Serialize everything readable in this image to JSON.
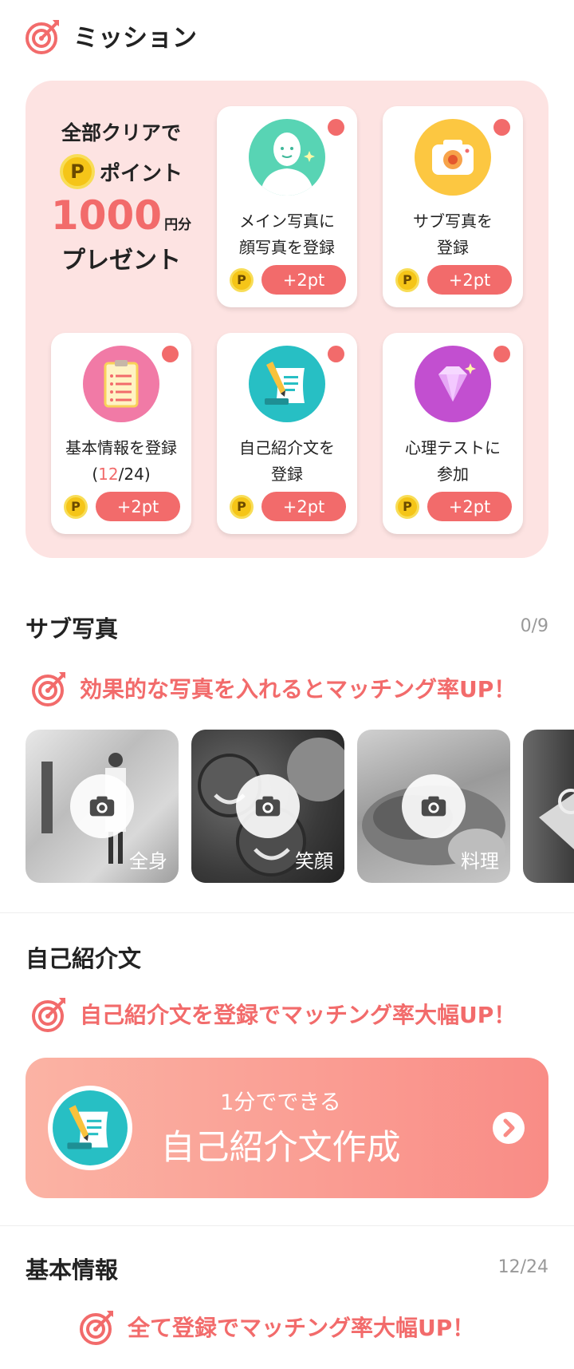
{
  "header": {
    "title": "ミッション",
    "icon": "target-icon"
  },
  "mission": {
    "clear_line1": "全部クリアで",
    "coin_label": "P",
    "points_label": "ポイント",
    "amount": "1000",
    "unit": "円分",
    "present": "プレゼント",
    "accent_color": "#f26b6b",
    "cards": [
      {
        "line1": "メイン写真に",
        "line2": "顔写真を登録",
        "reward": "+2pt",
        "icon": "user-photo-icon"
      },
      {
        "line1": "サブ写真を",
        "line2": "登録",
        "reward": "+2pt",
        "icon": "camera-icon"
      },
      {
        "line1": "基本情報を登録",
        "progress_open": "(",
        "progress_done": "12",
        "progress_rest": "/24)",
        "reward": "+2pt",
        "icon": "clipboard-icon"
      },
      {
        "line1": "自己紹介文を",
        "line2": "登録",
        "reward": "+2pt",
        "icon": "writing-icon"
      },
      {
        "line1": "心理テストに",
        "line2": "参加",
        "reward": "+2pt",
        "icon": "diamond-icon"
      }
    ]
  },
  "sub_photos": {
    "title": "サブ写真",
    "count": "0/9",
    "promo": "効果的な写真を入れるとマッチング率UP！",
    "items": [
      {
        "label": "全身"
      },
      {
        "label": "笑顔"
      },
      {
        "label": "料理"
      },
      {
        "label": ""
      }
    ]
  },
  "self_intro": {
    "title": "自己紹介文",
    "promo": "自己紹介文を登録でマッチング率大幅UP！",
    "banner_sub": "1分でできる",
    "banner_main": "自己紹介文作成"
  },
  "basic_info": {
    "title": "基本情報",
    "count": "12/24",
    "promo": "全て登録でマッチング率大幅UP！"
  }
}
